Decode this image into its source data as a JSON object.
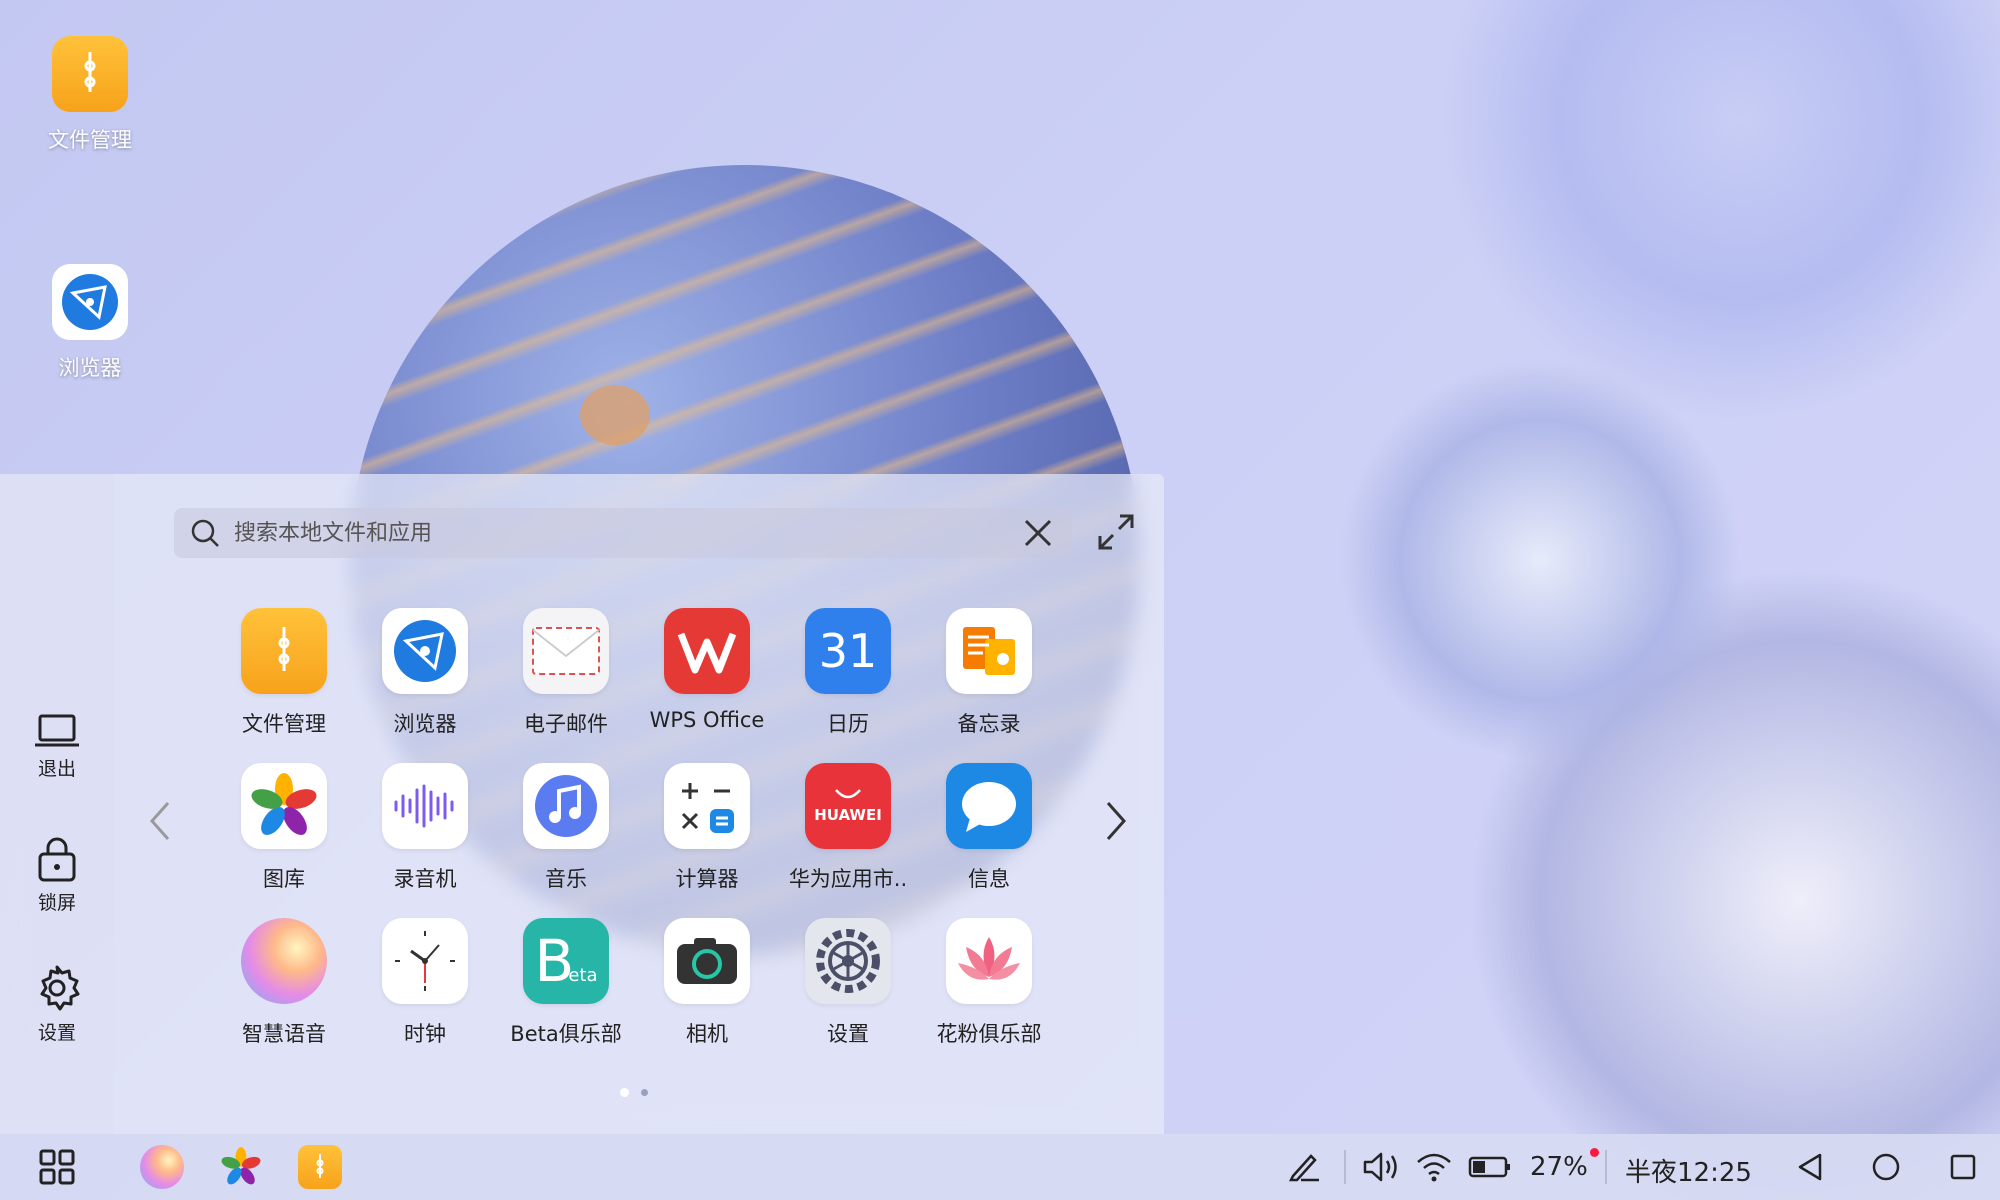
{
  "desktop": {
    "icons": [
      {
        "label": "文件管理",
        "icon": "file-manager-icon"
      },
      {
        "label": "浏览器",
        "icon": "browser-icon"
      }
    ]
  },
  "panel": {
    "search": {
      "placeholder": "搜索本地文件和应用"
    },
    "rail": [
      {
        "label": "退出",
        "icon": "laptop-icon"
      },
      {
        "label": "锁屏",
        "icon": "lock-icon"
      },
      {
        "label": "设置",
        "icon": "gear-icon"
      }
    ],
    "apps": [
      {
        "label": "文件管理",
        "icon": "file-manager-icon"
      },
      {
        "label": "浏览器",
        "icon": "browser-icon"
      },
      {
        "label": "电子邮件",
        "icon": "email-icon"
      },
      {
        "label": "WPS Office",
        "icon": "wps-office-icon"
      },
      {
        "label": "日历",
        "icon": "calendar-icon",
        "glyph": "31"
      },
      {
        "label": "备忘录",
        "icon": "notes-icon"
      },
      {
        "label": "图库",
        "icon": "gallery-icon"
      },
      {
        "label": "录音机",
        "icon": "recorder-icon"
      },
      {
        "label": "音乐",
        "icon": "music-icon"
      },
      {
        "label": "计算器",
        "icon": "calculator-icon"
      },
      {
        "label": "华为应用市..",
        "icon": "appgallery-icon",
        "glyph": "HUAWEI"
      },
      {
        "label": "信息",
        "icon": "messages-icon"
      },
      {
        "label": "智慧语音",
        "icon": "voice-assistant-icon"
      },
      {
        "label": "时钟",
        "icon": "clock-icon"
      },
      {
        "label": "Beta俱乐部",
        "icon": "beta-club-icon",
        "glyph": "B",
        "glyph_small": "eta"
      },
      {
        "label": "相机",
        "icon": "camera-icon"
      },
      {
        "label": "设置",
        "icon": "settings-icon"
      },
      {
        "label": "花粉俱乐部",
        "icon": "fans-club-icon"
      }
    ],
    "pages": {
      "count": 2,
      "current": 1
    }
  },
  "taskbar": {
    "battery_percent": "27%",
    "time": "半夜12:25",
    "pinned": [
      "voice-assistant-icon",
      "gallery-icon",
      "file-manager-icon"
    ]
  },
  "colors": {
    "accent_orange": "#f9a825",
    "wps_red": "#e53935",
    "calendar_blue": "#2f80ed",
    "huawei_red": "#e8333a",
    "message_blue": "#1e88e5",
    "beta_teal": "#26b5a6"
  }
}
